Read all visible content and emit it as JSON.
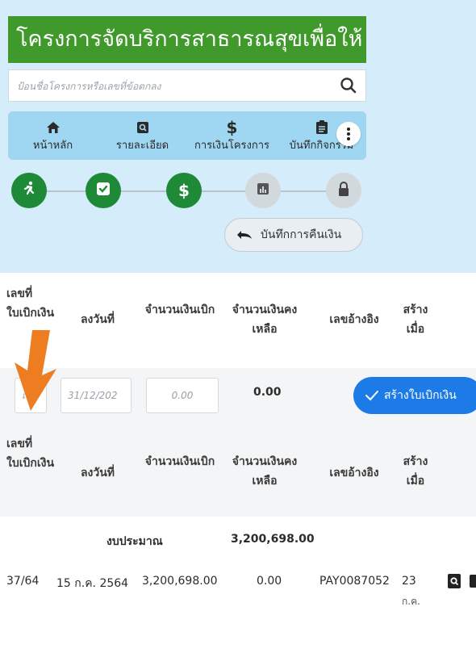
{
  "app": {
    "title": "โครงการจัดบริการสาธารณสุขเพื่อให้"
  },
  "search": {
    "placeholder": "ป้อนชื่อโครงการหรือเลขที่ข้อตกลง",
    "icon": "search-icon"
  },
  "nav": {
    "items": [
      {
        "label": "หน้าหลัก",
        "icon": "home-icon"
      },
      {
        "label": "รายละเอียด",
        "icon": "details-icon"
      },
      {
        "label": "การเงินโครงการ",
        "icon": "dollar-icon"
      },
      {
        "label": "บันทึกกิจกรรม",
        "icon": "clipboard-icon"
      }
    ],
    "more_icon": "more-vertical-icon"
  },
  "steps": [
    {
      "icon": "running-icon",
      "status": "done"
    },
    {
      "icon": "check-shield-icon",
      "status": "done"
    },
    {
      "icon": "dollar-icon",
      "status": "done"
    },
    {
      "icon": "chart-icon",
      "status": "pending"
    },
    {
      "icon": "lock-icon",
      "status": "pending"
    }
  ],
  "refund": {
    "label": "บันทึกการคืนเงิน"
  },
  "form_header": {
    "col1": "เลขที่ใบเบิกเงิน",
    "col2": "ลงวันที่",
    "col3": "จำนวนเงินเบิก",
    "col4": "จำนวนเงินคงเหลือ",
    "col5": "เลขอ้างอิง",
    "col6": "สร้างเมื่อ"
  },
  "form": {
    "number_placeholder": "เลข",
    "date_value": "31/12/202",
    "amount_placeholder": "0.00",
    "remaining": "0.00",
    "create_label": "สร้างใบเบิกเงิน"
  },
  "table_header": {
    "col1": "เลขที่ใบเบิกเงิน",
    "col2": "ลงวันที่",
    "col3": "จำนวนเงินเบิก",
    "col4": "จำนวนเงินคงเหลือ",
    "col5": "เลขอ้างอิง",
    "col6": "สร้างเมื่อ"
  },
  "budget": {
    "label": "งบประมาณ",
    "amount": "3,200,698.00"
  },
  "rows": [
    {
      "number": "37/64",
      "date": "15 ก.ค. 2564",
      "amount": "3,200,698.00",
      "remaining": "0.00",
      "ref": "PAY0087052",
      "created_day": "23",
      "created_month": "ก.ค."
    }
  ],
  "colors": {
    "brand_green": "#3f9a2b",
    "step_green": "#1e8a37",
    "accent_blue": "#1d7be8",
    "light_blue": "#d5ecfa",
    "arrow_orange": "#ee7d22"
  }
}
